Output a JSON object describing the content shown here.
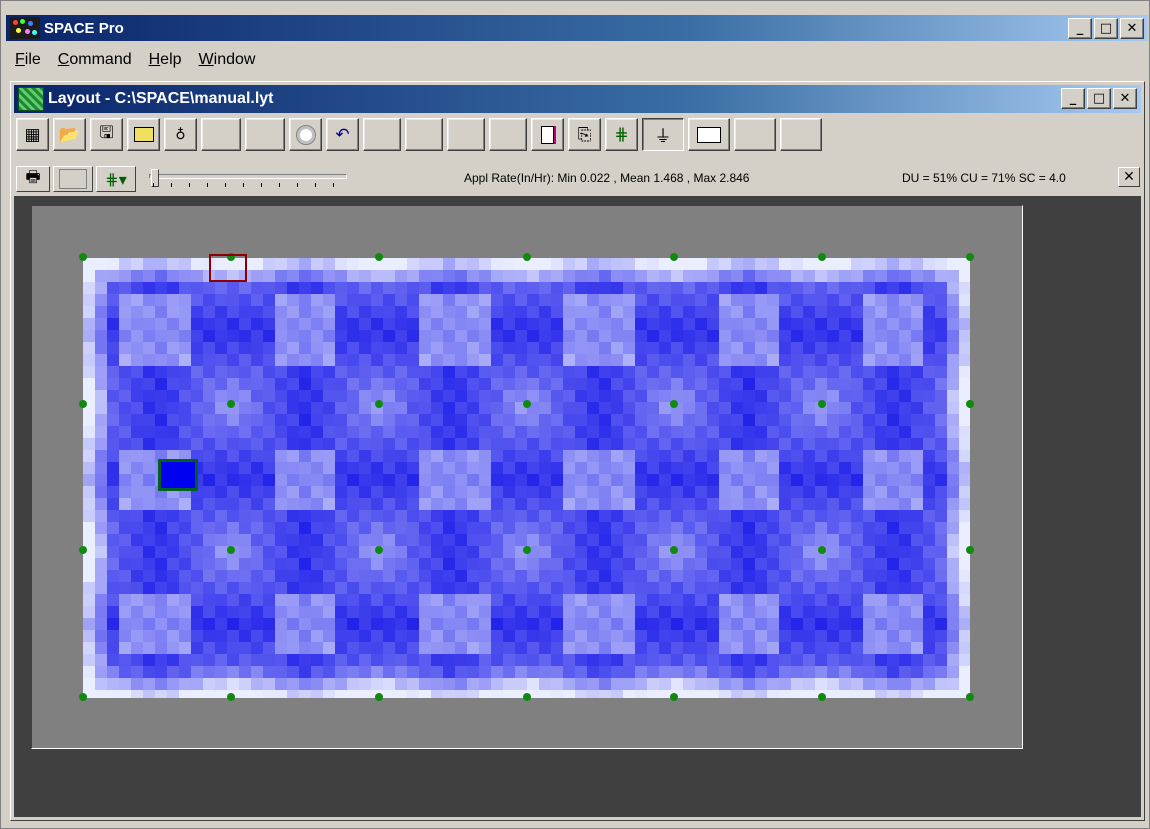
{
  "app": {
    "title": "SPACE Pro",
    "window_buttons": [
      "_",
      "□",
      "✕"
    ]
  },
  "menu": {
    "items": [
      {
        "label": "File",
        "access_key": "F"
      },
      {
        "label": "Command",
        "access_key": "C"
      },
      {
        "label": "Help",
        "access_key": "H"
      },
      {
        "label": "Window",
        "access_key": "W"
      }
    ]
  },
  "layout_window": {
    "title": "Layout - C:\\SPACE\\manual.lyt"
  },
  "toolbar": {
    "icons": [
      "grid-icon",
      "open-folder-icon",
      "save-disk-icon",
      "folder-icon",
      "sprinkler-select-icon",
      "blank",
      "blank",
      "timer-icon",
      "undo-icon",
      "blank",
      "blank",
      "blank",
      "blank",
      "page-icon",
      "copy-icon",
      "spacing-grid-icon",
      "catch-can-icon",
      "preview-icon",
      "blank",
      "blank"
    ]
  },
  "status": {
    "appl_rate": "Appl Rate(In/Hr): Min 0.022 , Mean 1.468 , Max 2.846",
    "uniformity": "DU = 51% CU = 71% SC = 4.0",
    "close_label": "✕",
    "scale_slider_fraction": 0.0
  },
  "colors": {
    "titlebar_start": "#0a246a",
    "titlebar_end": "#a6caf0",
    "sprinkler": "#0f8a0f",
    "selection_red": "#8b0000",
    "selection_green": "#006020",
    "workspace_bg": "#404040",
    "frame_bg": "#808080"
  },
  "layout": {
    "sprinkler_rows": 4,
    "sprinkler_cols": 7
  }
}
